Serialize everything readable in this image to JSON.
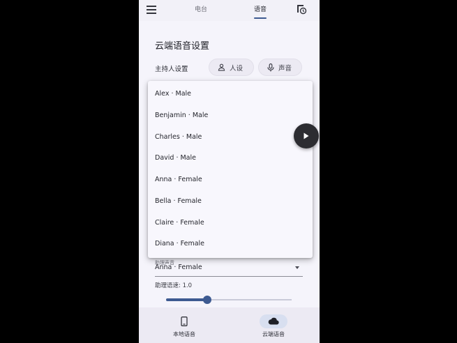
{
  "tabs": [
    {
      "label": "电台",
      "active": false
    },
    {
      "label": "语音",
      "active": true
    }
  ],
  "section_title": "云端语音设置",
  "host_label": "主持人设置",
  "chips": {
    "persona": {
      "label": "人设",
      "icon": "person-icon"
    },
    "voice": {
      "label": "声音",
      "icon": "mic-icon"
    }
  },
  "voice_menu": {
    "items": [
      "Alex · Male",
      "Benjamin · Male",
      "Charles · Male",
      "David · Male",
      "Anna · Female",
      "Bella · Female",
      "Claire · Female",
      "Diana · Female"
    ]
  },
  "assistant_voice": {
    "label": "助理声音",
    "value": "Anna · Female"
  },
  "assistant_rate": {
    "label": "助理语速: 1.0",
    "value": 1.0,
    "fill_fraction": 0.33
  },
  "bottom_nav": [
    {
      "label": "本地语音",
      "icon": "phone-icon",
      "selected": false
    },
    {
      "label": "云端语音",
      "icon": "cloud-icon",
      "selected": true
    }
  ],
  "colors": {
    "accent": "#3d5a91",
    "background": "#f5f4fb",
    "play_button": "#2c2c31"
  }
}
